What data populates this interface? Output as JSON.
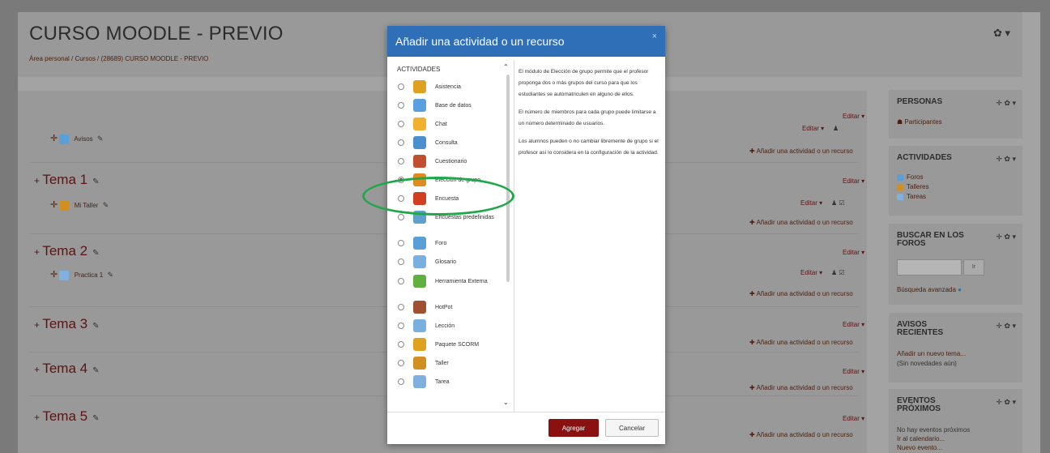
{
  "course": {
    "title": "CURSO MOODLE - PREVIO",
    "breadcrumb": "Área personal / Cursos / (28689) CURSO MOODLE - PREVIO"
  },
  "header_gear": "✿ ▾",
  "sections": [
    {
      "title": "Tema 1"
    },
    {
      "title": "Tema 2"
    },
    {
      "title": "Tema 3"
    },
    {
      "title": "Tema 4"
    },
    {
      "title": "Tema 5"
    }
  ],
  "items": {
    "avisos": "Avisos",
    "mi_taller": "Mi Taller",
    "practica": "Practica 1"
  },
  "labels": {
    "editar": "Editar ▾",
    "add_activity": "Añadir una actividad o un recurso"
  },
  "blocks": {
    "personas": {
      "title": "PERSONAS",
      "link": "Participantes"
    },
    "actividades": {
      "title": "ACTIVIDADES",
      "links": [
        "Foros",
        "Talleres",
        "Tareas"
      ]
    },
    "buscar": {
      "title1": "BUSCAR EN LOS",
      "title2": "FOROS",
      "button": "Ir",
      "advanced": "Búsqueda avanzada"
    },
    "avisos": {
      "title1": "AVISOS",
      "title2": "RECIENTES",
      "add": "Añadir un nuevo tema...",
      "none": "(Sin novedades aún)"
    },
    "eventos": {
      "title1": "EVENTOS",
      "title2": "PRÓXIMOS",
      "none": "No hay eventos próximos",
      "cal": "Ir al calendario...",
      "new": "Nuevo evento..."
    }
  },
  "modal": {
    "title": "Añadir una actividad o un recurso",
    "close": "×",
    "list_heading": "ACTIVIDADES",
    "activities": [
      {
        "label": "Asistencia",
        "color": "#e0a020"
      },
      {
        "label": "Base de datos",
        "color": "#5aa0e0"
      },
      {
        "label": "Chat",
        "color": "#f2b030"
      },
      {
        "label": "Consulta",
        "color": "#4a90d0"
      },
      {
        "label": "Cuestionario",
        "color": "#c05030"
      },
      {
        "label": "Elección de grupo",
        "color": "#e08a20",
        "selected": true
      },
      {
        "label": "Encuesta",
        "color": "#d04020"
      },
      {
        "label": "Encuestas predefinidas",
        "color": "#60a0d0"
      },
      {
        "label": "Foro",
        "color": "#5aa0d8"
      },
      {
        "label": "Glosario",
        "color": "#7ab0e0"
      },
      {
        "label": "Herramienta Externa",
        "color": "#60b040"
      },
      {
        "label": "HotPot",
        "color": "#a05030"
      },
      {
        "label": "Lección",
        "color": "#7ab0e0"
      },
      {
        "label": "Paquete SCORM",
        "color": "#e0a020"
      },
      {
        "label": "Taller",
        "color": "#d09020"
      },
      {
        "label": "Tarea",
        "color": "#80b0e0"
      }
    ],
    "description": [
      "El módulo de Elección de grupo permite que el profesor proponga dos o más grupos del curso para que los estudiantes se automatriculen en alguno de ellos.",
      "El número de miembros para cada grupo puede limitarse a un número determinado de usuarios.",
      "Los alumnos pueden o no cambiar libremente de grupo si el profesor así lo considera en la configuración de la actividad."
    ],
    "add_button": "Agregar",
    "cancel_button": "Cancelar"
  }
}
